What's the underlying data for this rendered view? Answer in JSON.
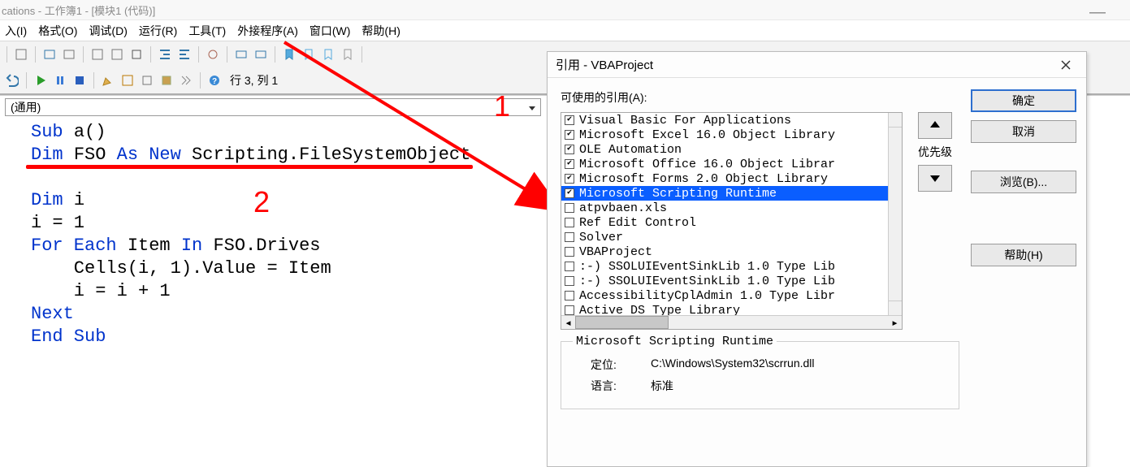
{
  "window": {
    "title": "cations - 工作簿1 - [模块1 (代码)]"
  },
  "menu": {
    "insert": "入(I)",
    "format": "格式(O)",
    "debug": "调试(D)",
    "run": "运行(R)",
    "tools": "工具(T)",
    "addins": "外接程序(A)",
    "window": "窗口(W)",
    "help": "帮助(H)"
  },
  "status": {
    "cursor": "行 3, 列 1"
  },
  "combo": {
    "value": "(通用)"
  },
  "code": {
    "l1a": "Sub ",
    "l1b": "a()",
    "l2a": "Dim ",
    "l2b": "FSO ",
    "l2c": "As New ",
    "l2d": "Scripting.FileSystemObject",
    "l3": "",
    "l4a": "Dim ",
    "l4b": "i",
    "l5": "i = 1",
    "l6a": "For Each ",
    "l6b": "Item ",
    "l6c": "In ",
    "l6d": "FSO.Drives",
    "l7": "    Cells(i, 1).Value = Item",
    "l8": "    i = i + 1",
    "l9": "Next",
    "l10": "End Sub"
  },
  "annotations": {
    "n1": "1",
    "n2": "2"
  },
  "dialog": {
    "title": "引用 - VBAProject",
    "label": "可使用的引用(A):",
    "buttons": {
      "ok": "确定",
      "cancel": "取消",
      "browse": "浏览(B)...",
      "help": "帮助(H)"
    },
    "priority_label": "优先级",
    "refs": [
      {
        "checked": true,
        "selected": false,
        "text": "Visual Basic For Applications"
      },
      {
        "checked": true,
        "selected": false,
        "text": "Microsoft Excel 16.0 Object Library"
      },
      {
        "checked": true,
        "selected": false,
        "text": "OLE Automation"
      },
      {
        "checked": true,
        "selected": false,
        "text": "Microsoft Office 16.0 Object Librar"
      },
      {
        "checked": true,
        "selected": false,
        "text": "Microsoft Forms 2.0 Object Library"
      },
      {
        "checked": true,
        "selected": true,
        "text": "Microsoft Scripting Runtime"
      },
      {
        "checked": false,
        "selected": false,
        "text": "atpvbaen.xls"
      },
      {
        "checked": false,
        "selected": false,
        "text": "Ref Edit Control"
      },
      {
        "checked": false,
        "selected": false,
        "text": "Solver"
      },
      {
        "checked": false,
        "selected": false,
        "text": "VBAProject"
      },
      {
        "checked": false,
        "selected": false,
        "text": ":-) SSOLUIEventSinkLib 1.0 Type Lib"
      },
      {
        "checked": false,
        "selected": false,
        "text": ":-) SSOLUIEventSinkLib 1.0 Type Lib"
      },
      {
        "checked": false,
        "selected": false,
        "text": "AccessibilityCplAdmin 1.0 Type Libr"
      },
      {
        "checked": false,
        "selected": false,
        "text": "Active DS Type Library"
      }
    ],
    "detail": {
      "title": "Microsoft Scripting Runtime",
      "location_label": "定位:",
      "location": "C:\\Windows\\System32\\scrrun.dll",
      "lang_label": "语言:",
      "lang": "标准"
    }
  }
}
